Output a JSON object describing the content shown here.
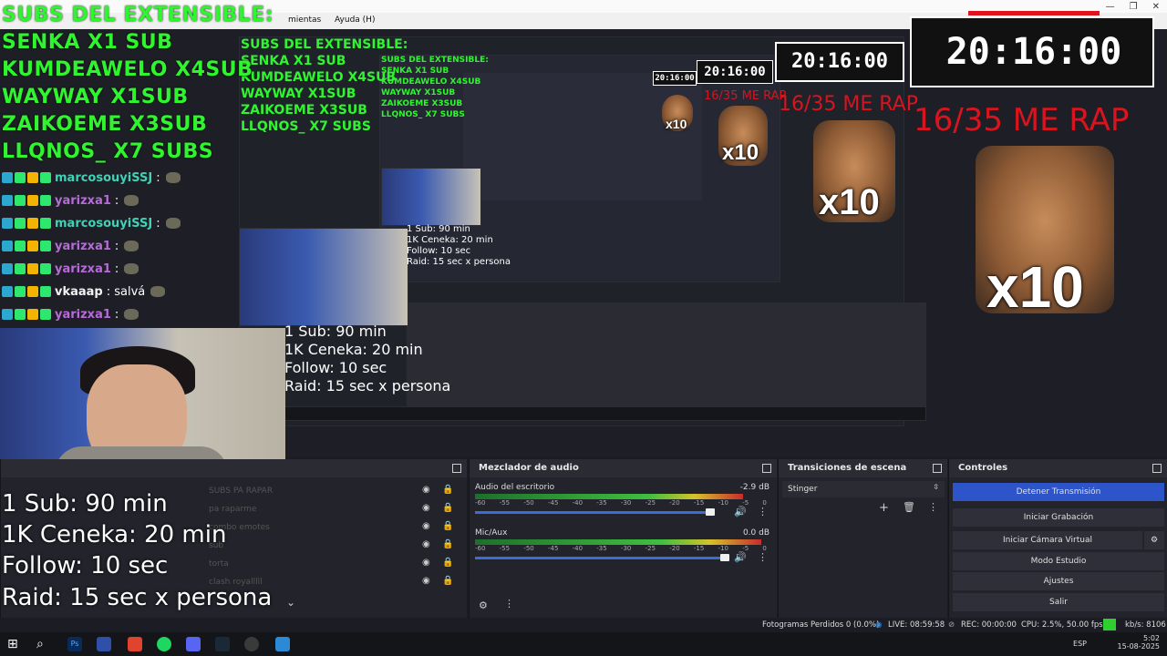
{
  "menubar": {
    "items": [
      "mientas",
      "Ayuda (H)"
    ]
  },
  "subs": {
    "title": "SUBS DEL EXTENSIBLE:",
    "lines": [
      "SENKA X1 SUB",
      "KUMDEAWELO X4SUB",
      "WAYWAY X1SUB",
      "ZAIKOEME X3SUB",
      "LLQNOS_ X7 SUBS"
    ]
  },
  "chat": {
    "rows": [
      {
        "user": "marcosouyiSSJ",
        "msg": ":",
        "color": "#41d1b5"
      },
      {
        "user": "yarizxa1",
        "msg": ":",
        "color": "#b66bd8"
      },
      {
        "user": "marcosouyiSSJ",
        "msg": ":",
        "color": "#41d1b5"
      },
      {
        "user": "yarizxa1",
        "msg": ":",
        "color": "#b66bd8"
      },
      {
        "user": "yarizxa1",
        "msg": ":",
        "color": "#b66bd8"
      },
      {
        "user": "vkaaap",
        "msg": ": salvá",
        "color": "#f2f2f2"
      },
      {
        "user": "yarizxa1",
        "msg": ":",
        "color": "#b66bd8"
      }
    ]
  },
  "timer": {
    "value": "20:16:00"
  },
  "raid": {
    "text": "16/35 ME RAP"
  },
  "dog": {
    "label": "x10"
  },
  "info": {
    "lines": [
      "1 Sub: 90 min",
      "1K Ceneka: 20 min",
      "Follow: 10 sec",
      "Raid: 15 sec x persona"
    ]
  },
  "scenes_ghost": [
    "SUBS PA RAPAR",
    "pa raparme",
    "combo emotes",
    "sub",
    "torta",
    "clash royalllll"
  ],
  "mixer": {
    "title": "Mezclador de audio",
    "tracks": [
      {
        "name": "Audio del escritorio",
        "db": "-2.9 dB",
        "level": 0.92
      },
      {
        "name": "Mic/Aux",
        "db": "0.0 dB",
        "level": 0.98
      }
    ],
    "scale": [
      "-60",
      "-55",
      "-50",
      "-45",
      "-40",
      "-35",
      "-30",
      "-25",
      "-20",
      "-15",
      "-10",
      "-5",
      "0"
    ]
  },
  "transitions": {
    "title": "Transiciones de escena",
    "selected": "Stinger"
  },
  "controls": {
    "title": "Controles",
    "buttons": [
      "Detener Transmisión",
      "Iniciar Grabación",
      "Iniciar Cámara Virtual",
      "Modo Estudio",
      "Ajustes",
      "Salir"
    ]
  },
  "status": {
    "dropped": "Fotogramas Perdidos 0 (0.0%)",
    "live": "LIVE: 08:59:58",
    "rec": "REC: 00:00:00",
    "cpu": "CPU: 2.5%, 50.00 fps",
    "kbps": "kb/s: 8106"
  },
  "tray": {
    "lang": "ESP",
    "time": "5:02",
    "date": "15-08-2025"
  },
  "colors": {
    "accent": "#2d55c9",
    "subs": "#2ef52e",
    "raid": "#d8141e"
  }
}
